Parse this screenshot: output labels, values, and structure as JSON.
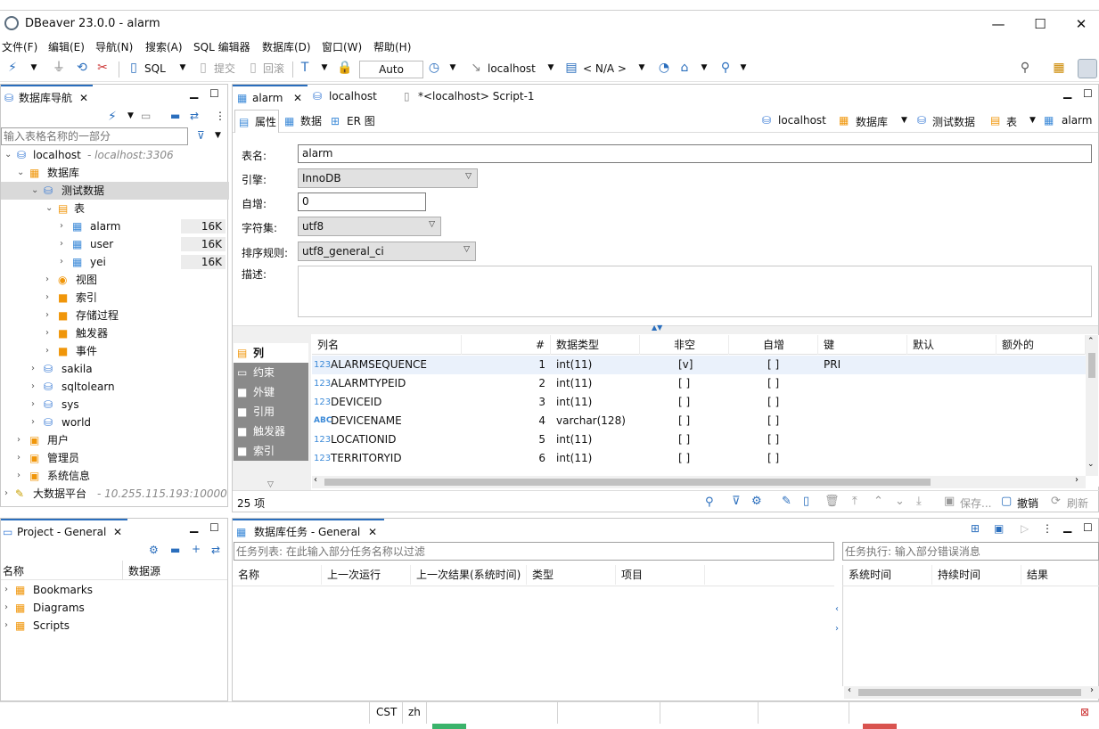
{
  "window": {
    "title": "DBeaver 23.0.0 - alarm",
    "minimize": "—",
    "maximize": "☐",
    "close": "✕"
  },
  "menu": [
    "文件(F)",
    "编辑(E)",
    "导航(N)",
    "搜索(A)",
    "SQL 编辑器",
    "数据库(D)",
    "窗口(W)",
    "帮助(H)"
  ],
  "toolbar": {
    "sql": "SQL",
    "commit": "提交",
    "rollback": "回滚",
    "auto": "Auto",
    "connection": "localhost",
    "schema": "< N/A >"
  },
  "navigator": {
    "tab": "数据库导航",
    "filter_placeholder": "输入表格名称的一部分",
    "tree": [
      {
        "label": "localhost",
        "extra": "- localhost:3306"
      },
      {
        "label": "数据库"
      },
      {
        "label": "测试数据"
      },
      {
        "label": "表"
      },
      {
        "label": "alarm",
        "size": "16K"
      },
      {
        "label": "user",
        "size": "16K"
      },
      {
        "label": "yei",
        "size": "16K"
      },
      {
        "label": "视图"
      },
      {
        "label": "索引"
      },
      {
        "label": "存储过程"
      },
      {
        "label": "触发器"
      },
      {
        "label": "事件"
      },
      {
        "label": "sakila"
      },
      {
        "label": "sqltolearn"
      },
      {
        "label": "sys"
      },
      {
        "label": "world"
      },
      {
        "label": "用户"
      },
      {
        "label": "管理员"
      },
      {
        "label": "系统信息"
      },
      {
        "label": "大数据平台",
        "extra": "- 10.255.115.193:10000"
      }
    ]
  },
  "editor": {
    "tabs": [
      "alarm",
      "localhost",
      "*<localhost> Script-1"
    ],
    "subtabs": [
      "属性",
      "数据",
      "ER 图"
    ],
    "crumbs": [
      "localhost",
      "数据库",
      "测试数据",
      "表",
      "alarm"
    ],
    "props": {
      "name_label": "表名:",
      "name": "alarm",
      "engine_label": "引擎:",
      "engine": "InnoDB",
      "autoinc_label": "自增:",
      "autoinc": "0",
      "charset_label": "字符集:",
      "charset": "utf8",
      "collation_label": "排序规则:",
      "collation": "utf8_general_ci",
      "desc_label": "描述:"
    },
    "sidetabs": [
      "列",
      "约束",
      "外键",
      "引用",
      "触发器",
      "索引"
    ],
    "columns_header": [
      "列名",
      "#",
      "数据类型",
      "非空",
      "自增",
      "键",
      "默认",
      "额外的"
    ],
    "rows": [
      {
        "icon": "123",
        "name": "ALARMSEQUENCE",
        "n": "1",
        "type": "int(11)",
        "notnull": "[v]",
        "ai": "[ ]",
        "key": "PRI"
      },
      {
        "icon": "123",
        "name": "ALARMTYPEID",
        "n": "2",
        "type": "int(11)",
        "notnull": "[ ]",
        "ai": "[ ]",
        "key": ""
      },
      {
        "icon": "123",
        "name": "DEVICEID",
        "n": "3",
        "type": "int(11)",
        "notnull": "[ ]",
        "ai": "[ ]",
        "key": ""
      },
      {
        "icon": "ABC",
        "name": "DEVICENAME",
        "n": "4",
        "type": "varchar(128)",
        "notnull": "[ ]",
        "ai": "[ ]",
        "key": ""
      },
      {
        "icon": "123",
        "name": "LOCATIONID",
        "n": "5",
        "type": "int(11)",
        "notnull": "[ ]",
        "ai": "[ ]",
        "key": ""
      },
      {
        "icon": "123",
        "name": "TERRITORYID",
        "n": "6",
        "type": "int(11)",
        "notnull": "[ ]",
        "ai": "[ ]",
        "key": ""
      }
    ],
    "count": "25 项",
    "save": "保存...",
    "cancel": "撤销",
    "refresh": "刷新"
  },
  "project": {
    "tab": "Project - General",
    "col_name": "名称",
    "col_source": "数据源",
    "items": [
      "Bookmarks",
      "Diagrams",
      "Scripts"
    ]
  },
  "tasks": {
    "tab": "数据库任务 - General",
    "filter_placeholder": "任务列表: 在此输入部分任务名称以过滤",
    "error_placeholder": "任务执行: 输入部分错误消息",
    "cols": [
      "名称",
      "上一次运行",
      "上一次结果(系统时间)",
      "类型",
      "项目"
    ],
    "exec_cols": [
      "系统时间",
      "持续时间",
      "结果"
    ]
  },
  "status": {
    "tz": "CST",
    "lang": "zh"
  },
  "colors": {
    "accent": "#2a6ebd",
    "folder": "#f0960a",
    "db": "#3a7bd5",
    "table": "#3c8ad8"
  }
}
